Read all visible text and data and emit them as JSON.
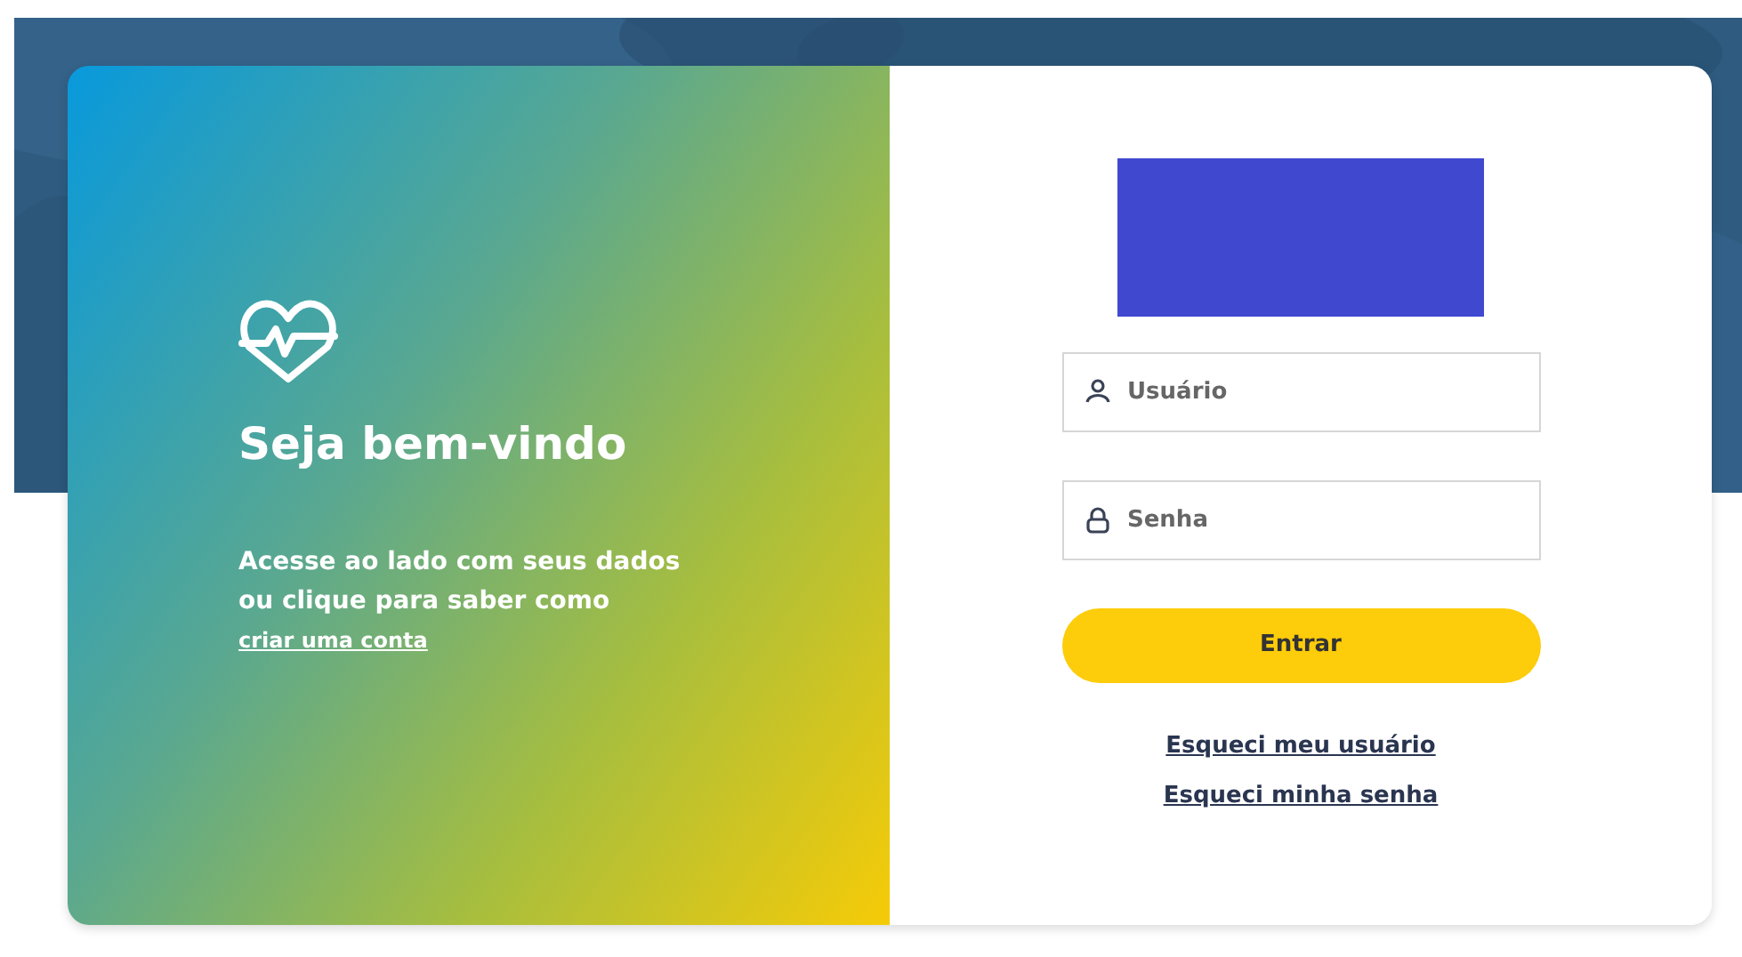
{
  "welcome": {
    "title": "Seja bem-vindo",
    "text": "Acesse ao lado com seus dados ou clique para saber como",
    "link": "criar uma conta"
  },
  "login": {
    "fields": [
      {
        "kind": "user",
        "placeholder": "Usuário"
      },
      {
        "kind": "password",
        "placeholder": "Senha"
      }
    ],
    "submit": "Entrar",
    "links": [
      "Esqueci meu usuário",
      "Esqueci minha senha"
    ]
  }
}
